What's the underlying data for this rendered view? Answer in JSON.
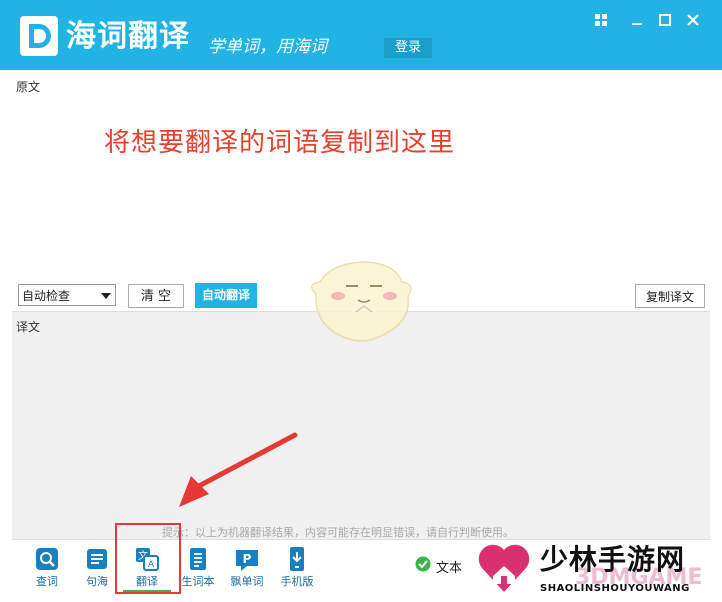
{
  "app": {
    "title": "海词翻译",
    "slogan": "学单词，用海词",
    "login_label": "登录"
  },
  "source": {
    "label": "原文",
    "hint": "将想要翻译的词语复制到这里"
  },
  "toolbar": {
    "lang_select_value": "自动检查",
    "clear_label": "清 空",
    "auto_translate_label": "自动翻译",
    "copy_label": "复制译文"
  },
  "target": {
    "label": "译文",
    "hint": "提示：以上为机器翻译结果，内容可能存在明显错误，请自行判断使用。"
  },
  "nav": {
    "items": [
      {
        "label": "查词",
        "icon": "search-icon"
      },
      {
        "label": "句海",
        "icon": "sentence-icon"
      },
      {
        "label": "翻译",
        "icon": "translate-icon"
      },
      {
        "label": "生词本",
        "icon": "wordbook-icon"
      },
      {
        "label": "飘单词",
        "icon": "float-word-icon"
      },
      {
        "label": "手机版",
        "icon": "mobile-icon"
      }
    ],
    "active": "翻译"
  },
  "status": {
    "text": "文本"
  },
  "watermark": {
    "cn": "少林手游网",
    "en": "SHAOLINSHOUYOUWANG",
    "brand": "3DMGAME"
  },
  "colors": {
    "brand": "#21b3e3",
    "hint_red": "#e8402e",
    "highlight": "#e53935",
    "active_underline": "#3cb24a"
  }
}
